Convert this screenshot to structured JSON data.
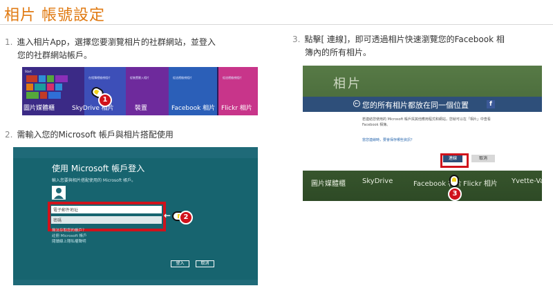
{
  "page": {
    "title": "相片 帳號設定",
    "title_color": "#e07a12"
  },
  "steps": [
    {
      "num": "1.",
      "line1": "進入相片App，選擇您要瀏覽相片的社群網站，並登入",
      "line2": "您的社群網站帳戶。"
    },
    {
      "num": "2.",
      "line1": "需輸入您的Microsoft 帳戶與相片搭配使用"
    },
    {
      "num": "3.",
      "line1": "點擊[ 連線]，即可透過相片快速瀏覽您的Facebook 相",
      "line2": "簿內的所有相片。"
    }
  ],
  "shot1": {
    "start_label": "Start",
    "panels": [
      {
        "label": "圖片媒體櫃",
        "color": "#2a1a5a",
        "caption": ""
      },
      {
        "label": "SkyDrive 相片",
        "color": "#3d4fb8",
        "caption": "在相簿裡檢視相片"
      },
      {
        "label": "裝置",
        "color": "#6e2a9c",
        "caption": "從裝置匯入相片"
      },
      {
        "label": "Facebook 相片",
        "color": "#2b5fb8",
        "caption": "從這裡檢視相片"
      },
      {
        "label": "Flickr 相片",
        "color": "#c8358a",
        "caption": "從這裡檢視相片"
      }
    ],
    "step_badge": "1"
  },
  "shot2": {
    "heading": "使用 Microsoft 帳戶登入",
    "subtitle": "輸入您要與相片搭配使用的 Microsoft 帳戶。",
    "email_placeholder": "電子郵件地址",
    "password_placeholder": "密碼",
    "links": [
      "無法存取您的帳戶？",
      "註冊 Microsoft 帳戶",
      "閱讀線上隱私權聲明"
    ],
    "ok_label": "登入",
    "cancel_label": "取消",
    "step_badge": "2"
  },
  "shot3": {
    "app_title": "相片",
    "dialog_title": "您的所有相片都放在同一個位置",
    "body_text": "若連結您使用的 Microsoft 帳戶與其他應用程式和網站，您就可以在「相片」中查看 Facebook 相簿。",
    "link": "當您連線時，要會保存哪些資訊？",
    "connect_label": "連線",
    "cancel_label": "取消",
    "strip": [
      "圖片媒體櫃",
      "SkyDrive",
      "Facebook 相片",
      "Flickr 相片",
      "Yvette-Va"
    ],
    "step_badge": "3"
  }
}
